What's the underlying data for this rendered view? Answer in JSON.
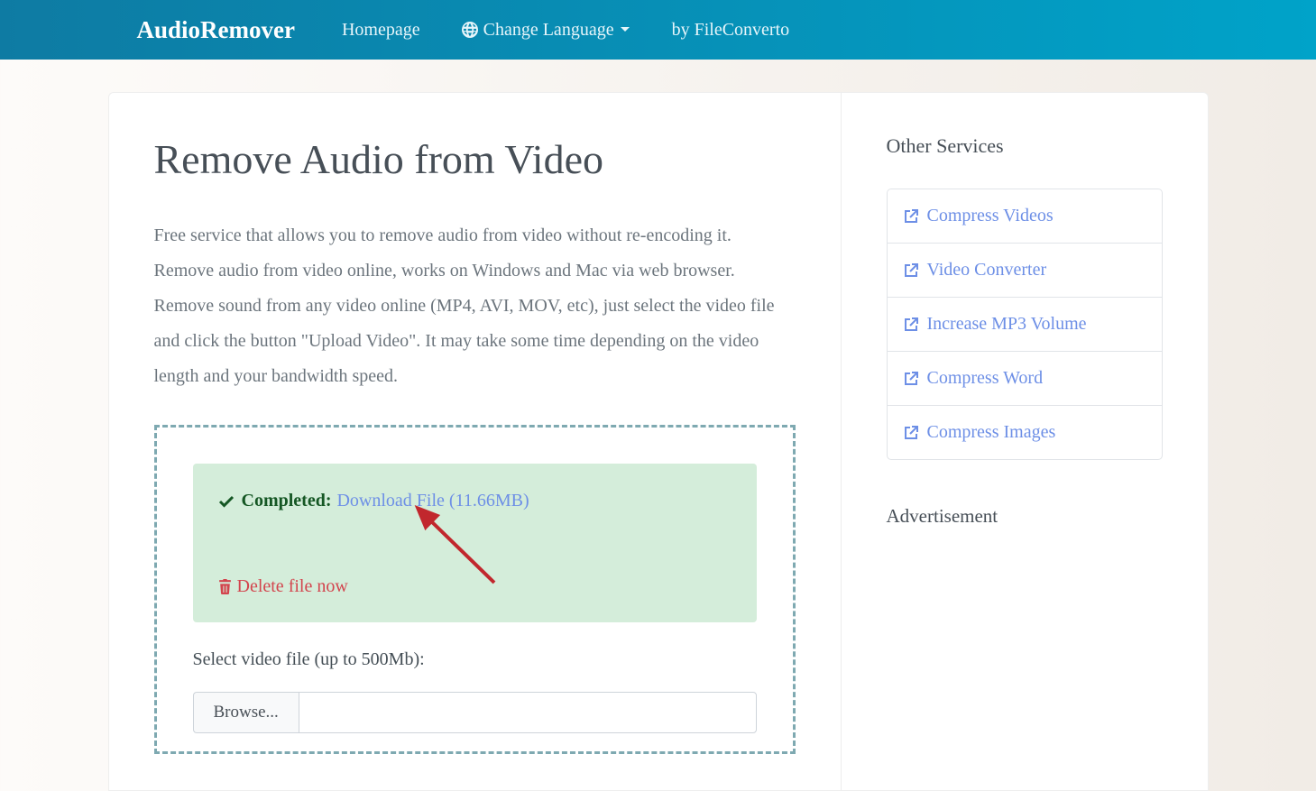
{
  "navbar": {
    "brand": "AudioRemover",
    "homepage": "Homepage",
    "change_language": "Change Language",
    "by": "by FileConverto"
  },
  "main": {
    "title": "Remove Audio from Video",
    "description": "Free service that allows you to remove audio from video without re-encoding it. Remove audio from video online, works on Windows and Mac via web browser. Remove sound from any video online (MP4, AVI, MOV, etc), just select the video file and click the button \"Upload Video\". It may take some time depending on the video length and your bandwidth speed.",
    "completed_label": "Completed:",
    "download_label": "Download File (11.66MB)",
    "delete_label": "Delete file now",
    "select_label": "Select video file (up to 500Mb):",
    "browse_label": "Browse..."
  },
  "sidebar": {
    "heading": "Other Services",
    "items": [
      "Compress Videos",
      "Video Converter",
      "Increase MP3 Volume",
      "Compress Word",
      "Compress Images"
    ],
    "ad_heading": "Advertisement"
  }
}
